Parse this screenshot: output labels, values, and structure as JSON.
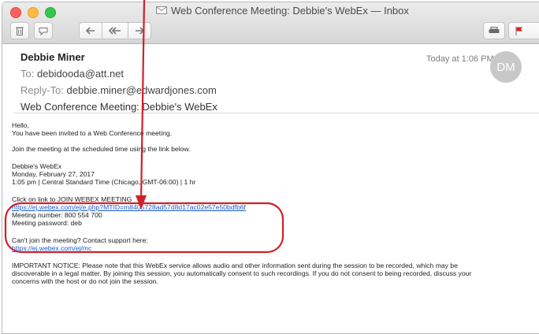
{
  "window": {
    "title": "Web Conference Meeting: Debbie's WebEx — Inbox"
  },
  "toolbar": {
    "buttons": [
      "trash-icon",
      "junk-icon",
      "reply-icon",
      "reply-all-icon",
      "forward-icon",
      "print-icon",
      "flag-icon"
    ]
  },
  "message": {
    "from": "Debbie Miner",
    "to_label": "To:",
    "to_value": "debidooda@att.net",
    "reply_to_label": "Reply-To:",
    "reply_to_value": "debbie.miner@edwardjones.com",
    "subject": "Web Conference Meeting: Debbie's WebEx",
    "date": "Today at 1:06 PM",
    "avatar_initials": "DM"
  },
  "body": {
    "greeting": "Hello,",
    "invited": "You have been invited to a Web Conference meeting.",
    "join_instruction": "Join the meeting at the scheduled time using the link below.",
    "meeting_name": "Debbie's WebEx",
    "meeting_date": "Monday, February 27, 2017",
    "meeting_time": "1:05 pm | Central Standard Time (Chicago, GMT-06:00) | 1 hr",
    "click_label": "Click on link to JOIN WEBEX MEETING",
    "join_link": "https://ej.webex.com/ej/e.php?MTID=m8405728ad57d8d17ac02e57e50bdfb6f",
    "meeting_number": "Meeting number: 800 554 700",
    "meeting_password": "Meeting password: deb",
    "support_text": "Can't join the meeting? Contact support here:",
    "support_link": "https://ej.webex.com/ej/mc",
    "notice_1": "IMPORTANT NOTICE: Please note that this WebEx service allows audio and other information sent during the session to be recorded, which may be",
    "notice_2": "discoverable in a legal matter. By joining this session, you automatically consent to such recordings. If you do not consent to being recorded, discuss your",
    "notice_3": "concerns with the host or do not join the session."
  },
  "colors": {
    "annotation": "#d0202a",
    "link": "#1a5bd5",
    "flag": "#e0201c"
  }
}
